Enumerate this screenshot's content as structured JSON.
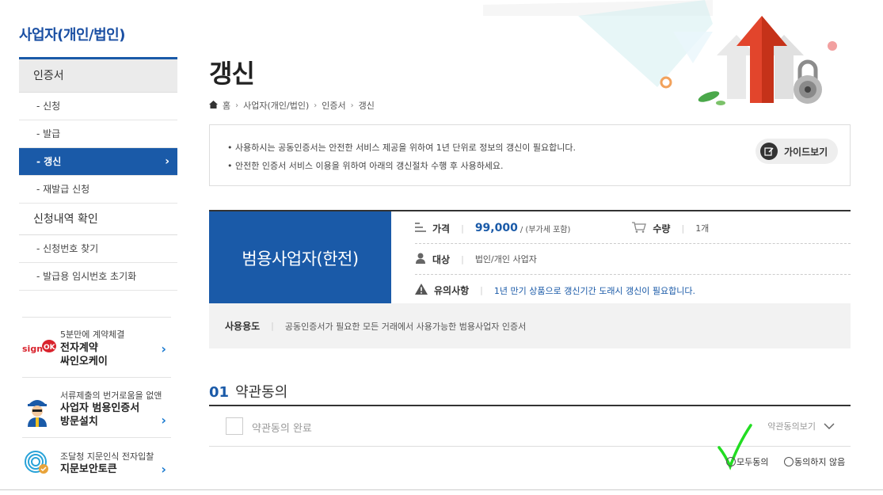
{
  "sidebar": {
    "title": "사업자(개인/법인)",
    "cert_category": "인증서",
    "items": [
      {
        "label": "- 신청"
      },
      {
        "label": "- 발급"
      },
      {
        "label": "- 갱신"
      },
      {
        "label": "- 재발급 신청"
      }
    ],
    "history_category": "신청내역 확인",
    "history_items": [
      {
        "label": "- 신청번호 찾기"
      },
      {
        "label": "- 발급용 임시번호 초기화"
      }
    ],
    "promos": [
      {
        "small": "5분만에 계약체결",
        "big1": "전자계약",
        "big2": "싸인오케이",
        "logo": "signOK"
      },
      {
        "small": "서류제출의 번거로움을 없앤",
        "big1": "사업자 범용인증서",
        "big2": "방문설치"
      },
      {
        "small": "조달청 지문인식 전자입찰",
        "big1": "지문보안토큰",
        "big2": ""
      }
    ]
  },
  "main": {
    "title": "갱신",
    "breadcrumb": [
      "홈",
      "사업자(개인/법인)",
      "인증서",
      "갱신"
    ],
    "notice": [
      "• 사용하시는 공동인증서는 안전한 서비스 제공을 위하여 1년 단위로 정보의 갱신이 필요합니다.",
      "• 안전한 인증서 서비스 이용을 위하여 아래의 갱신절차 수행 후 사용하세요."
    ],
    "guide_button": "가이드보기",
    "product": {
      "name": "범용사업자(한전)",
      "price_label": "가격",
      "price": "99,000",
      "price_note": "/ (부가세 포함)",
      "qty_label": "수량",
      "qty": "1개",
      "target_label": "대상",
      "target": "법인/개인 사업자",
      "caution_label": "유의사항",
      "caution": "1년 만기 상품으로 갱신기간 도래시 갱신이 필요합니다.",
      "usage_label": "사용용도",
      "usage": "공동인증서가 필요한 모든 거래에서 사용가능한 범용사업자 인증서"
    },
    "terms": {
      "num": "01",
      "title": "약관동의",
      "complete": "약관동의 완료",
      "view": "약관동의보기",
      "agree_all": "모두동의",
      "disagree": "동의하지 않음"
    }
  },
  "colors": {
    "accent": "#1a5aa8",
    "check_mark": "#22dd22"
  }
}
